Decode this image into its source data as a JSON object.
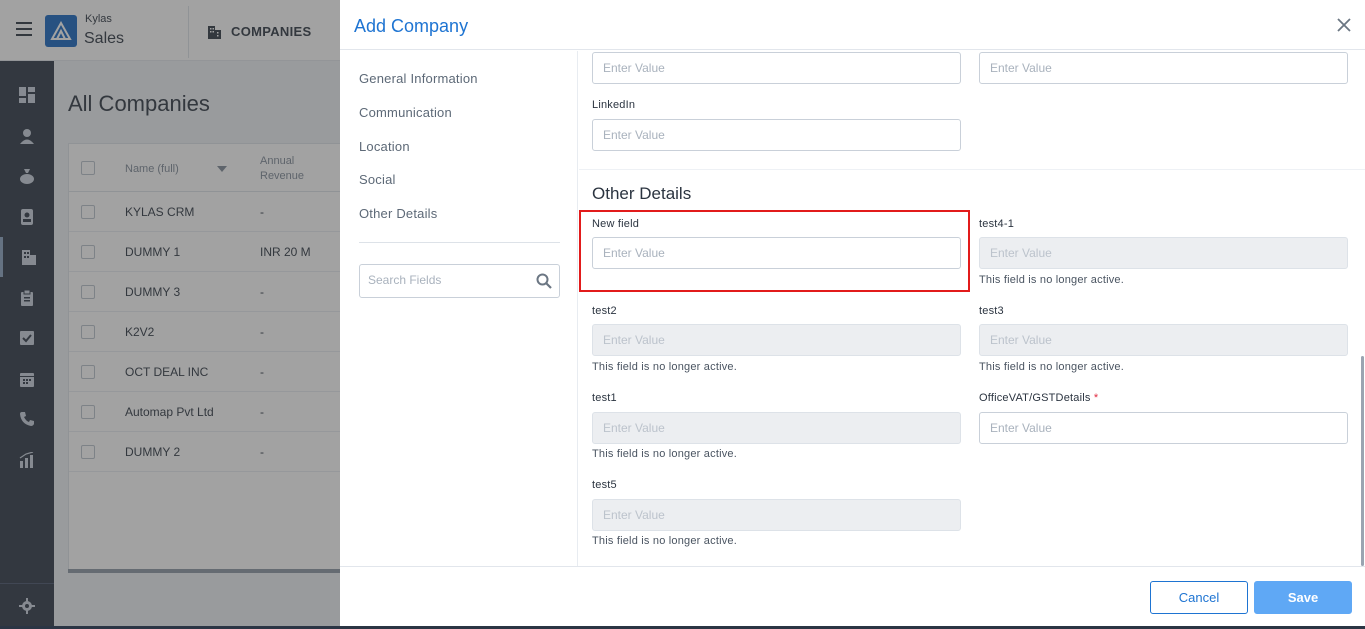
{
  "app": {
    "brand_line1": "Kylas",
    "brand_line2": "Sales",
    "module_label": "COMPANIES"
  },
  "sidebar_icons": [
    "dashboard-icon",
    "user-icon",
    "money-bag-icon",
    "contact-card-icon",
    "building-icon",
    "clipboard-icon",
    "checkbox-icon",
    "calendar-icon",
    "phone-icon",
    "reports-icon",
    "gear-icon"
  ],
  "page": {
    "title": "All Companies",
    "columns": {
      "name": "Name (full)",
      "revenue_line1": "Annual",
      "revenue_line2": "Revenue"
    },
    "rows": [
      {
        "name": "KYLAS CRM",
        "revenue": "-"
      },
      {
        "name": "DUMMY 1",
        "revenue": "INR 20 M"
      },
      {
        "name": "DUMMY 3",
        "revenue": "-"
      },
      {
        "name": "K2V2",
        "revenue": "-"
      },
      {
        "name": "OCT DEAL INC",
        "revenue": "-"
      },
      {
        "name": "Automap Pvt Ltd",
        "revenue": "-"
      },
      {
        "name": "DUMMY 2",
        "revenue": "-"
      }
    ]
  },
  "modal": {
    "title": "Add Company",
    "nav": [
      "General Information",
      "Communication",
      "Location",
      "Social",
      "Other Details"
    ],
    "search_placeholder": "Search Fields",
    "placeholder": "Enter Value",
    "linkedin_label": "LinkedIn",
    "section_title": "Other Details",
    "inactive_note": "This field is no longer active.",
    "fields": {
      "new_field": "New field",
      "test4_1": "test4-1",
      "test2": "test2",
      "test3": "test3",
      "test1": "test1",
      "office_vat": "OfficeVAT/GSTDetails",
      "required_mark": "*",
      "test5": "test5"
    },
    "cancel_label": "Cancel",
    "save_label": "Save"
  },
  "colors": {
    "accent": "#1e74d2",
    "save_bg": "#5fa8f5",
    "highlight": "#e21b1b",
    "sidebar": "#2b3544"
  }
}
